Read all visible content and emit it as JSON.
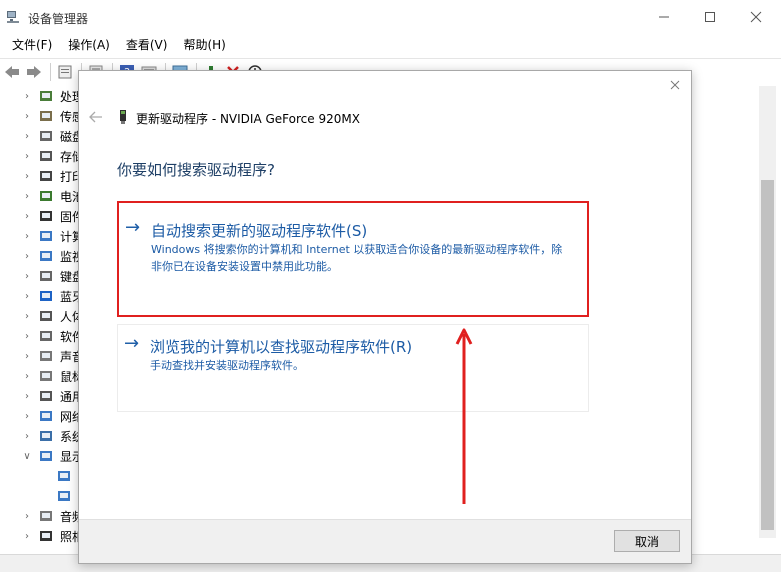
{
  "window": {
    "title": "设备管理器",
    "minimize_icon": "minimize-icon",
    "maximize_icon": "maximize-icon",
    "close_icon": "close-icon"
  },
  "menubar": {
    "file": "文件(F)",
    "action": "操作(A)",
    "view": "查看(V)",
    "help": "帮助(H)"
  },
  "toolbar": {
    "icons": [
      "back-icon",
      "forward-icon",
      "properties-icon",
      "update-driver-icon",
      "help-icon",
      "show-hidden-icon",
      "scan-icon",
      "enable-icon",
      "uninstall-icon",
      "download-icon"
    ]
  },
  "tree": {
    "items": [
      {
        "label": "处理",
        "icon": "processor-icon",
        "expanded": false
      },
      {
        "label": "传感",
        "icon": "sensor-icon",
        "expanded": false
      },
      {
        "label": "磁盘",
        "icon": "disk-icon",
        "expanded": false
      },
      {
        "label": "存储",
        "icon": "storage-icon",
        "expanded": false
      },
      {
        "label": "打印",
        "icon": "printer-icon",
        "expanded": false
      },
      {
        "label": "电池",
        "icon": "battery-icon",
        "expanded": false
      },
      {
        "label": "固件",
        "icon": "firmware-icon",
        "expanded": false
      },
      {
        "label": "计算",
        "icon": "computer-icon",
        "expanded": false
      },
      {
        "label": "监视",
        "icon": "monitor-icon",
        "expanded": false
      },
      {
        "label": "键盘",
        "icon": "keyboard-icon",
        "expanded": false
      },
      {
        "label": "蓝牙",
        "icon": "bluetooth-icon",
        "expanded": false
      },
      {
        "label": "人体",
        "icon": "hid-icon",
        "expanded": false
      },
      {
        "label": "软件",
        "icon": "software-icon",
        "expanded": false
      },
      {
        "label": "声音",
        "icon": "audio-icon",
        "expanded": false
      },
      {
        "label": "鼠标",
        "icon": "mouse-icon",
        "expanded": false
      },
      {
        "label": "通用",
        "icon": "usb-icon",
        "expanded": false
      },
      {
        "label": "网络",
        "icon": "network-icon",
        "expanded": false
      },
      {
        "label": "系统",
        "icon": "system-icon",
        "expanded": false
      },
      {
        "label": "显示",
        "icon": "display-adapter-icon",
        "expanded": true
      },
      {
        "label": "",
        "icon": "display-device-icon",
        "child": true
      },
      {
        "label": "",
        "icon": "display-device-icon",
        "child": true
      },
      {
        "label": "音频",
        "icon": "audio-io-icon",
        "expanded": false
      },
      {
        "label": "照相",
        "icon": "camera-icon",
        "expanded": false
      }
    ]
  },
  "dialog": {
    "title": "更新驱动程序 - NVIDIA GeForce 920MX",
    "question": "你要如何搜索驱动程序?",
    "option_auto": {
      "title": "自动搜索更新的驱动程序软件(S)",
      "description": "Windows 将搜索你的计算机和 Internet 以获取适合你设备的最新驱动程序软件，除非你已在设备安装设置中禁用此功能。"
    },
    "option_browse": {
      "title": "浏览我的计算机以查找驱动程序软件(R)",
      "description": "手动查找并安装驱动程序软件。"
    },
    "cancel_label": "取消"
  },
  "colors": {
    "highlight_border": "#e0201f",
    "link_blue": "#1c5ba5",
    "annotation_red": "#e0201f"
  }
}
